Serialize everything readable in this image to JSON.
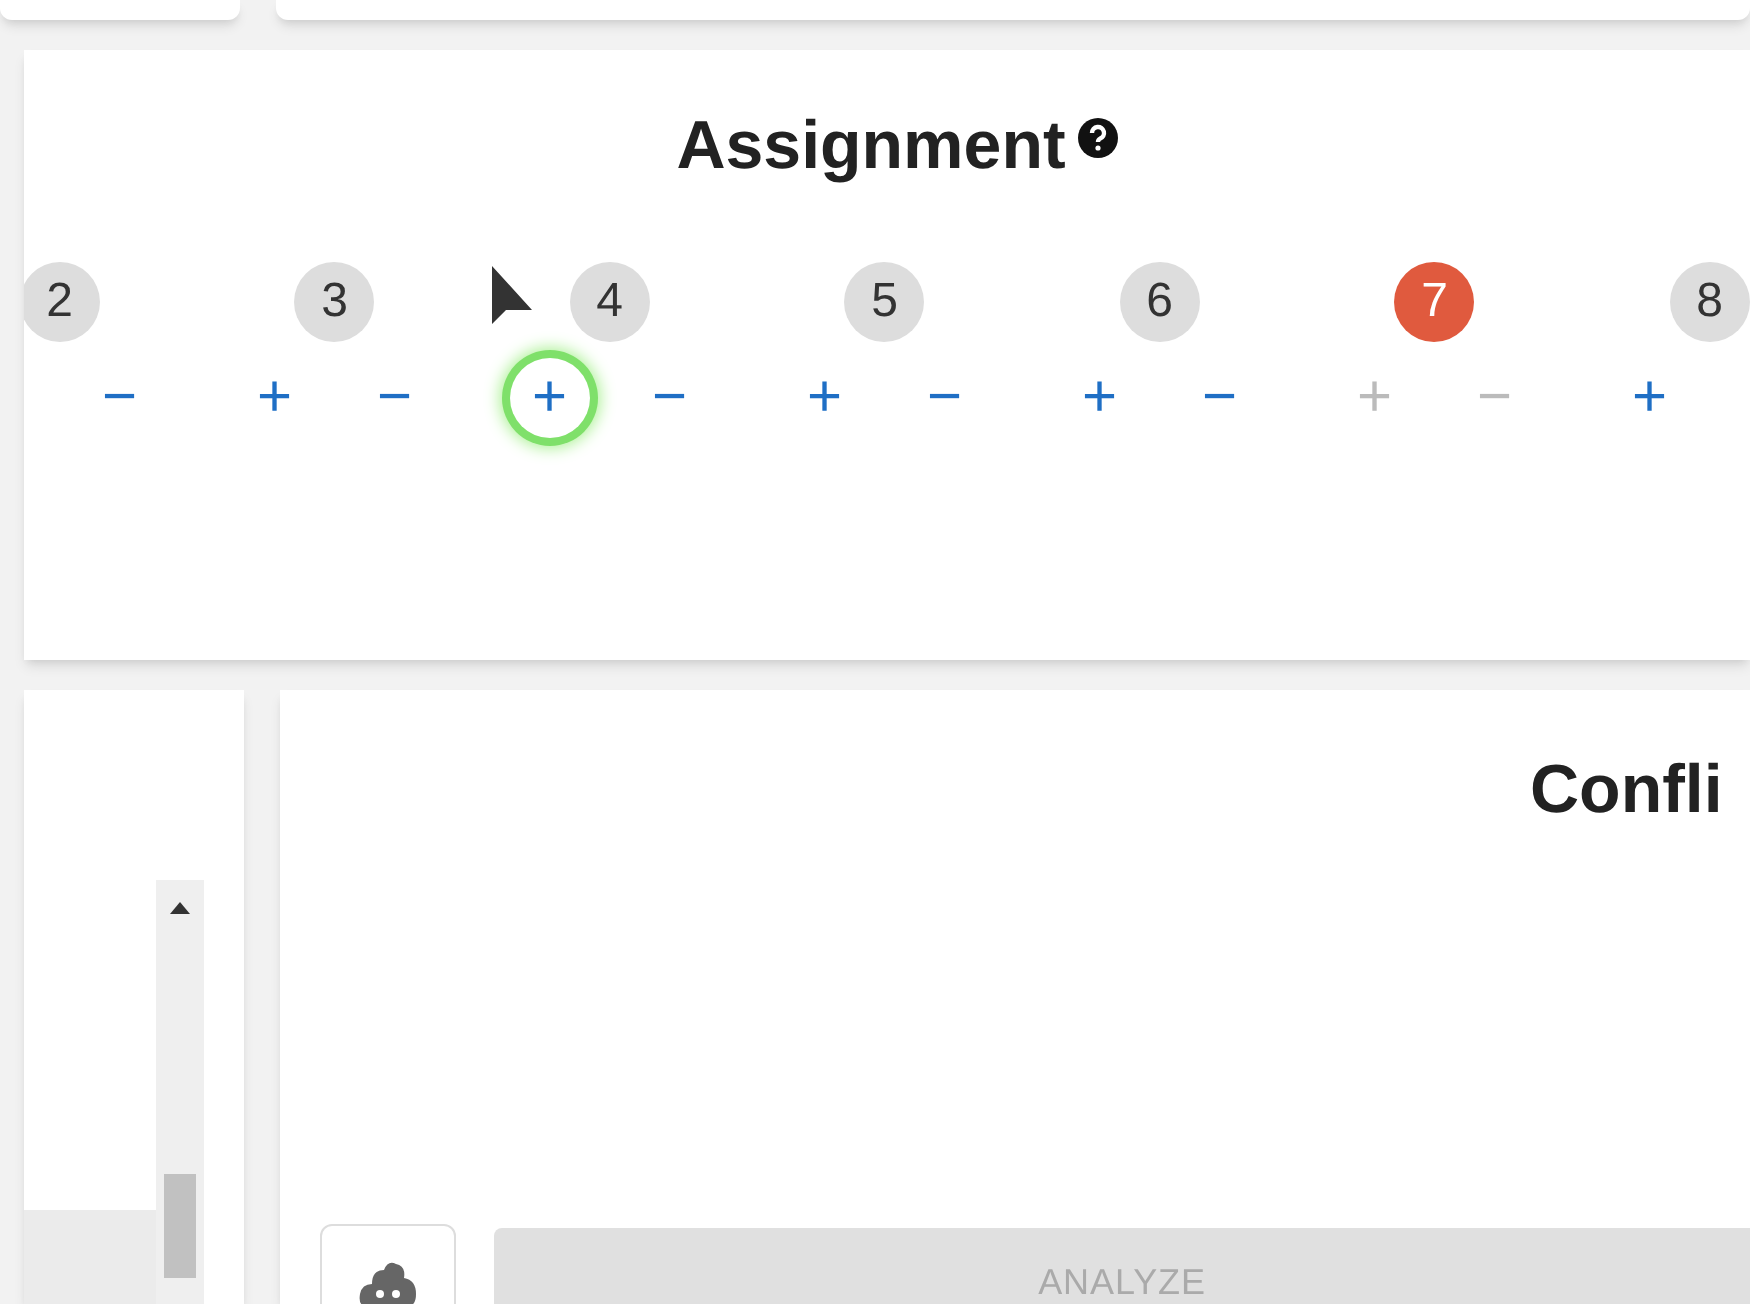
{
  "assignment": {
    "title": "Assignment",
    "variables": [
      {
        "label": "2",
        "conflict": false,
        "controls": [
          {
            "kind": "minus",
            "symbol": "−",
            "disabled": false,
            "focused": false
          }
        ]
      },
      {
        "label": "3",
        "conflict": false,
        "controls": [
          {
            "kind": "plus",
            "symbol": "+",
            "disabled": false,
            "focused": false
          },
          {
            "kind": "minus",
            "symbol": "−",
            "disabled": false,
            "focused": false
          }
        ]
      },
      {
        "label": "4",
        "conflict": false,
        "controls": [
          {
            "kind": "plus",
            "symbol": "+",
            "disabled": false,
            "focused": true
          },
          {
            "kind": "minus",
            "symbol": "−",
            "disabled": false,
            "focused": false
          }
        ]
      },
      {
        "label": "5",
        "conflict": false,
        "controls": [
          {
            "kind": "plus",
            "symbol": "+",
            "disabled": false,
            "focused": false
          },
          {
            "kind": "minus",
            "symbol": "−",
            "disabled": false,
            "focused": false
          }
        ]
      },
      {
        "label": "6",
        "conflict": false,
        "controls": [
          {
            "kind": "plus",
            "symbol": "+",
            "disabled": false,
            "focused": false
          },
          {
            "kind": "minus",
            "symbol": "−",
            "disabled": false,
            "focused": false
          }
        ]
      },
      {
        "label": "7",
        "conflict": true,
        "controls": [
          {
            "kind": "plus",
            "symbol": "+",
            "disabled": true,
            "focused": false
          },
          {
            "kind": "minus",
            "symbol": "−",
            "disabled": true,
            "focused": false
          }
        ]
      },
      {
        "label": "8",
        "conflict": false,
        "controls": [
          {
            "kind": "plus",
            "symbol": "+",
            "disabled": false,
            "focused": false
          }
        ]
      }
    ]
  },
  "conflicts": {
    "title": "Confli",
    "analyze_button": "ANALYZE"
  }
}
